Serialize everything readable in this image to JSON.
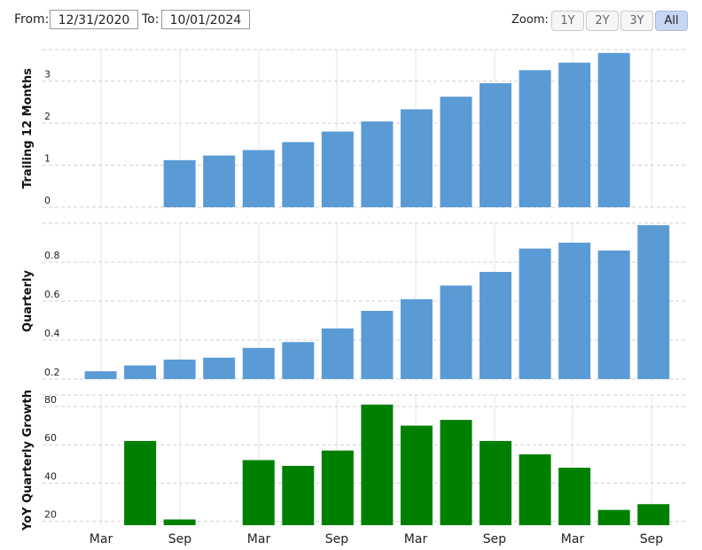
{
  "toolbar": {
    "from_label": "From:",
    "from_value": "12/31/2020",
    "to_label": "To:",
    "to_value": "10/01/2024",
    "zoom_label": "Zoom:",
    "zoom_buttons": [
      "1Y",
      "2Y",
      "3Y",
      "All"
    ],
    "zoom_active": "All"
  },
  "colors": {
    "blue": "#5b9bd5",
    "green": "#008000",
    "grid": "#d9d9d9"
  },
  "chart_data": [
    {
      "type": "bar",
      "ylabel": "Trailing 12 Months",
      "ylim": [
        0,
        3.75
      ],
      "yticks": [
        0,
        1,
        2,
        3
      ],
      "ytick_labels": [
        "0",
        "1",
        "2",
        "3"
      ],
      "color": "#5b9bd5",
      "categories": [
        "Dec 2020",
        "Mar 2021",
        "Jun 2021",
        "Sep 2021",
        "Dec 2021",
        "Mar 2022",
        "Jun 2022",
        "Sep 2022",
        "Dec 2022",
        "Mar 2023",
        "Jun 2023",
        "Sep 2023",
        "Dec 2023",
        "Mar 2024",
        "Jun 2024",
        "Sep 2024"
      ],
      "values": [
        null,
        null,
        null,
        1.12,
        1.23,
        1.36,
        1.55,
        1.8,
        2.04,
        2.33,
        2.63,
        2.95,
        3.26,
        3.44,
        3.67,
        null
      ]
    },
    {
      "type": "bar",
      "ylabel": "Quarterly",
      "ylim": [
        0.2,
        1.0
      ],
      "yticks": [
        0.2,
        0.4,
        0.6,
        0.8
      ],
      "ytick_labels": [
        "0.2",
        "0.4",
        "0.6",
        "0.8"
      ],
      "color": "#5b9bd5",
      "categories": [
        "Mar 2021",
        "Jun 2021",
        "Sep 2021",
        "Dec 2021",
        "Mar 2022",
        "Jun 2022",
        "Sep 2022",
        "Dec 2022",
        "Mar 2023",
        "Jun 2023",
        "Sep 2023",
        "Dec 2023",
        "Mar 2024",
        "Jun 2024",
        "Sep 2024"
      ],
      "values": [
        0.24,
        0.27,
        0.3,
        0.31,
        0.36,
        0.39,
        0.46,
        0.55,
        0.61,
        0.68,
        0.75,
        0.87,
        0.9,
        0.86,
        0.99
      ]
    },
    {
      "type": "bar",
      "ylabel": "YoY Quarterly Growth",
      "ylim": [
        18,
        86
      ],
      "yticks": [
        20,
        40,
        60,
        80
      ],
      "ytick_labels": [
        "20",
        "40",
        "60",
        "80"
      ],
      "color": "#008000",
      "categories": [
        "Mar 2021",
        "Jun 2021",
        "Sep 2021",
        "Dec 2021",
        "Mar 2022",
        "Jun 2022",
        "Sep 2022",
        "Dec 2022",
        "Mar 2023",
        "Jun 2023",
        "Sep 2023",
        "Dec 2023",
        "Mar 2024",
        "Jun 2024",
        "Sep 2024"
      ],
      "values": [
        null,
        62,
        21,
        null,
        52,
        49,
        57,
        81,
        70,
        73,
        62,
        55,
        48,
        26,
        29
      ],
      "xtick_labels": [
        "Mar",
        "Sep",
        "Mar",
        "Sep",
        "Mar",
        "Sep",
        "Mar",
        "Sep"
      ],
      "xtick_categories": [
        "Mar 2021",
        "Sep 2021",
        "Mar 2022",
        "Sep 2022",
        "Mar 2023",
        "Sep 2023",
        "Mar 2024",
        "Sep 2024"
      ]
    }
  ]
}
